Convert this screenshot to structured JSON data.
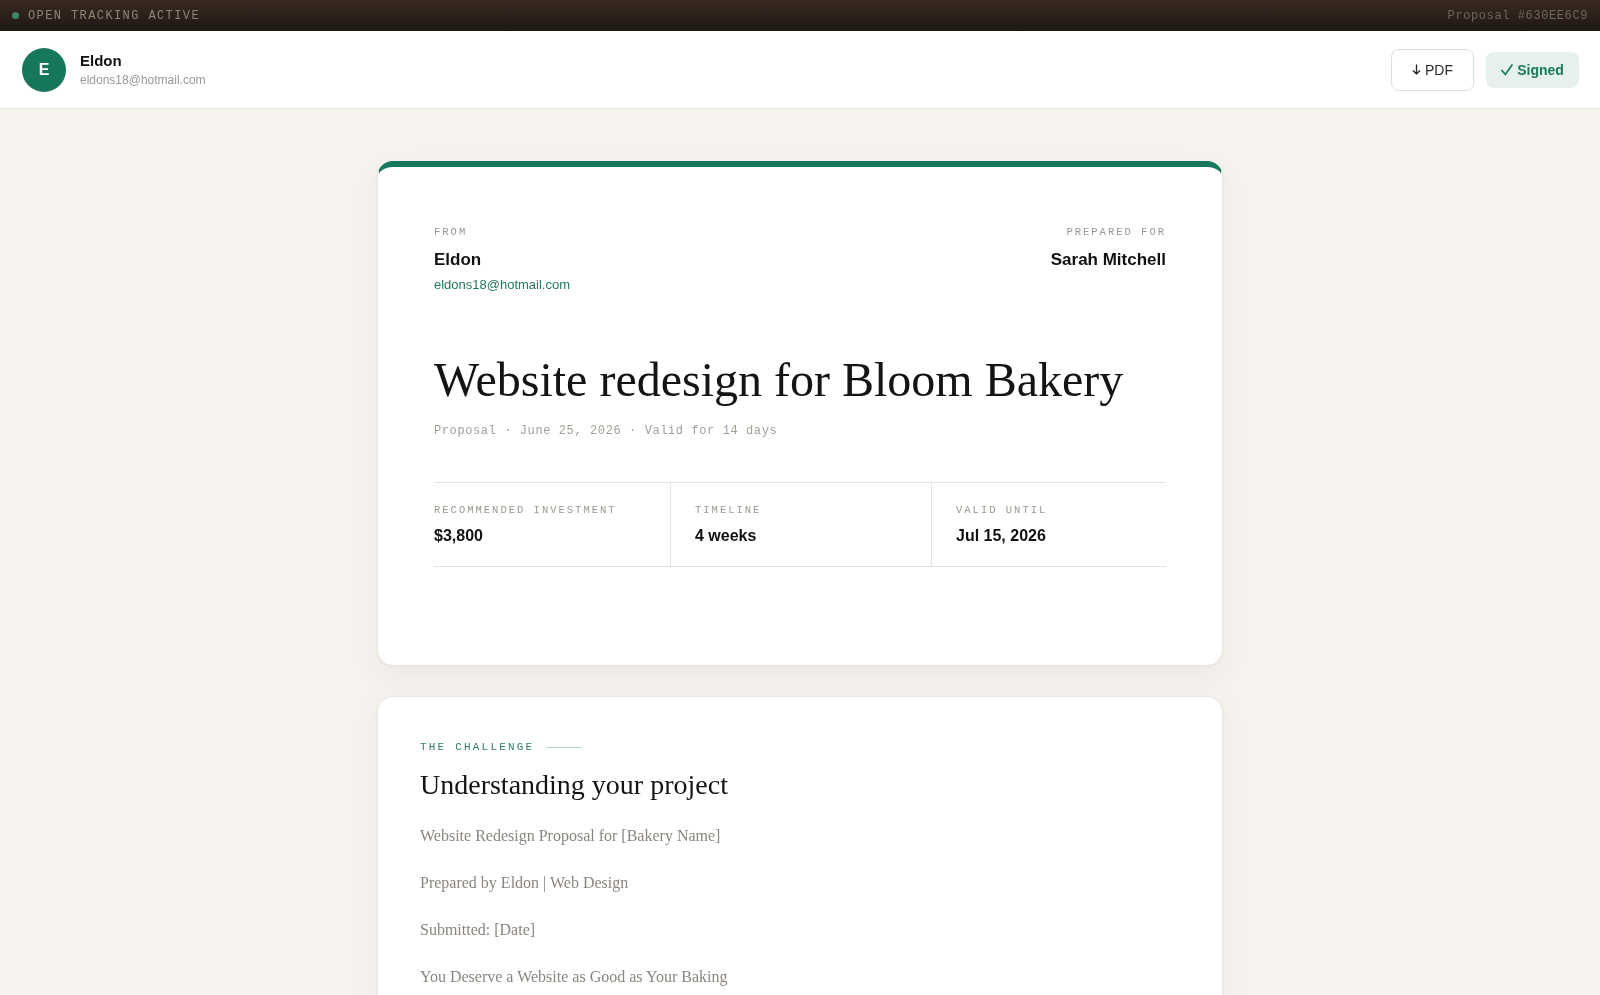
{
  "tracking_bar": {
    "status": "OPEN TRACKING ACTIVE",
    "active": true,
    "proposal_id": "Proposal #630EE6C9"
  },
  "header": {
    "avatar_initial": "E",
    "name": "Eldon",
    "email": "eldons18@hotmail.com",
    "buttons": [
      {
        "label": "PDF",
        "kind": "download"
      },
      {
        "label": "Signed",
        "kind": "signed"
      }
    ]
  },
  "cover": {
    "from": {
      "label": "FROM",
      "name": "Eldon",
      "email": "eldons18@hotmail.com"
    },
    "prepared_for": {
      "label": "PREPARED FOR",
      "name": "Sarah Mitchell"
    },
    "title": "Website redesign for Bloom Bakery",
    "meta": "Proposal · June 25, 2026 · Valid for 14 days",
    "stats": [
      {
        "label": "RECOMMENDED INVESTMENT",
        "value": "$3,800"
      },
      {
        "label": "TIMELINE",
        "value": "4 weeks"
      },
      {
        "label": "VALID UNTIL",
        "value": "Jul 15, 2026"
      }
    ]
  },
  "section": {
    "eyebrow": "THE CHALLENGE",
    "heading": "Understanding your project",
    "paragraphs": [
      "Website Redesign Proposal for [Bakery Name]",
      "Prepared by Eldon | Web Design",
      "Submitted: [Date]",
      "You Deserve a Website as Good as Your Baking"
    ]
  }
}
